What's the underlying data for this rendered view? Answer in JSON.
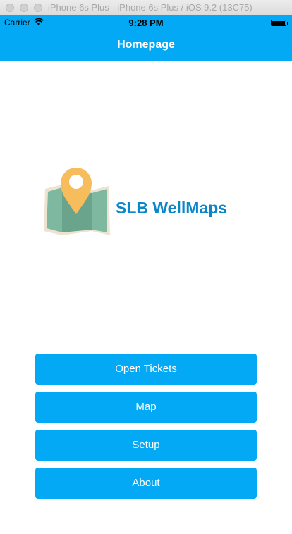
{
  "window": {
    "title": "iPhone 6s Plus - iPhone 6s Plus / iOS 9.2 (13C75)"
  },
  "status_bar": {
    "carrier": "Carrier",
    "time": "9:28 PM"
  },
  "nav_bar": {
    "title": "Homepage"
  },
  "logo": {
    "text": "SLB WellMaps",
    "icon": "map-pin-icon"
  },
  "buttons": [
    {
      "label": "Open Tickets"
    },
    {
      "label": "Map"
    },
    {
      "label": "Setup"
    },
    {
      "label": "About"
    }
  ],
  "colors": {
    "accent": "#03a9f4",
    "logo_text": "#0b86c9",
    "pin": "#f7bd5c",
    "map": "#7fb8a0"
  }
}
